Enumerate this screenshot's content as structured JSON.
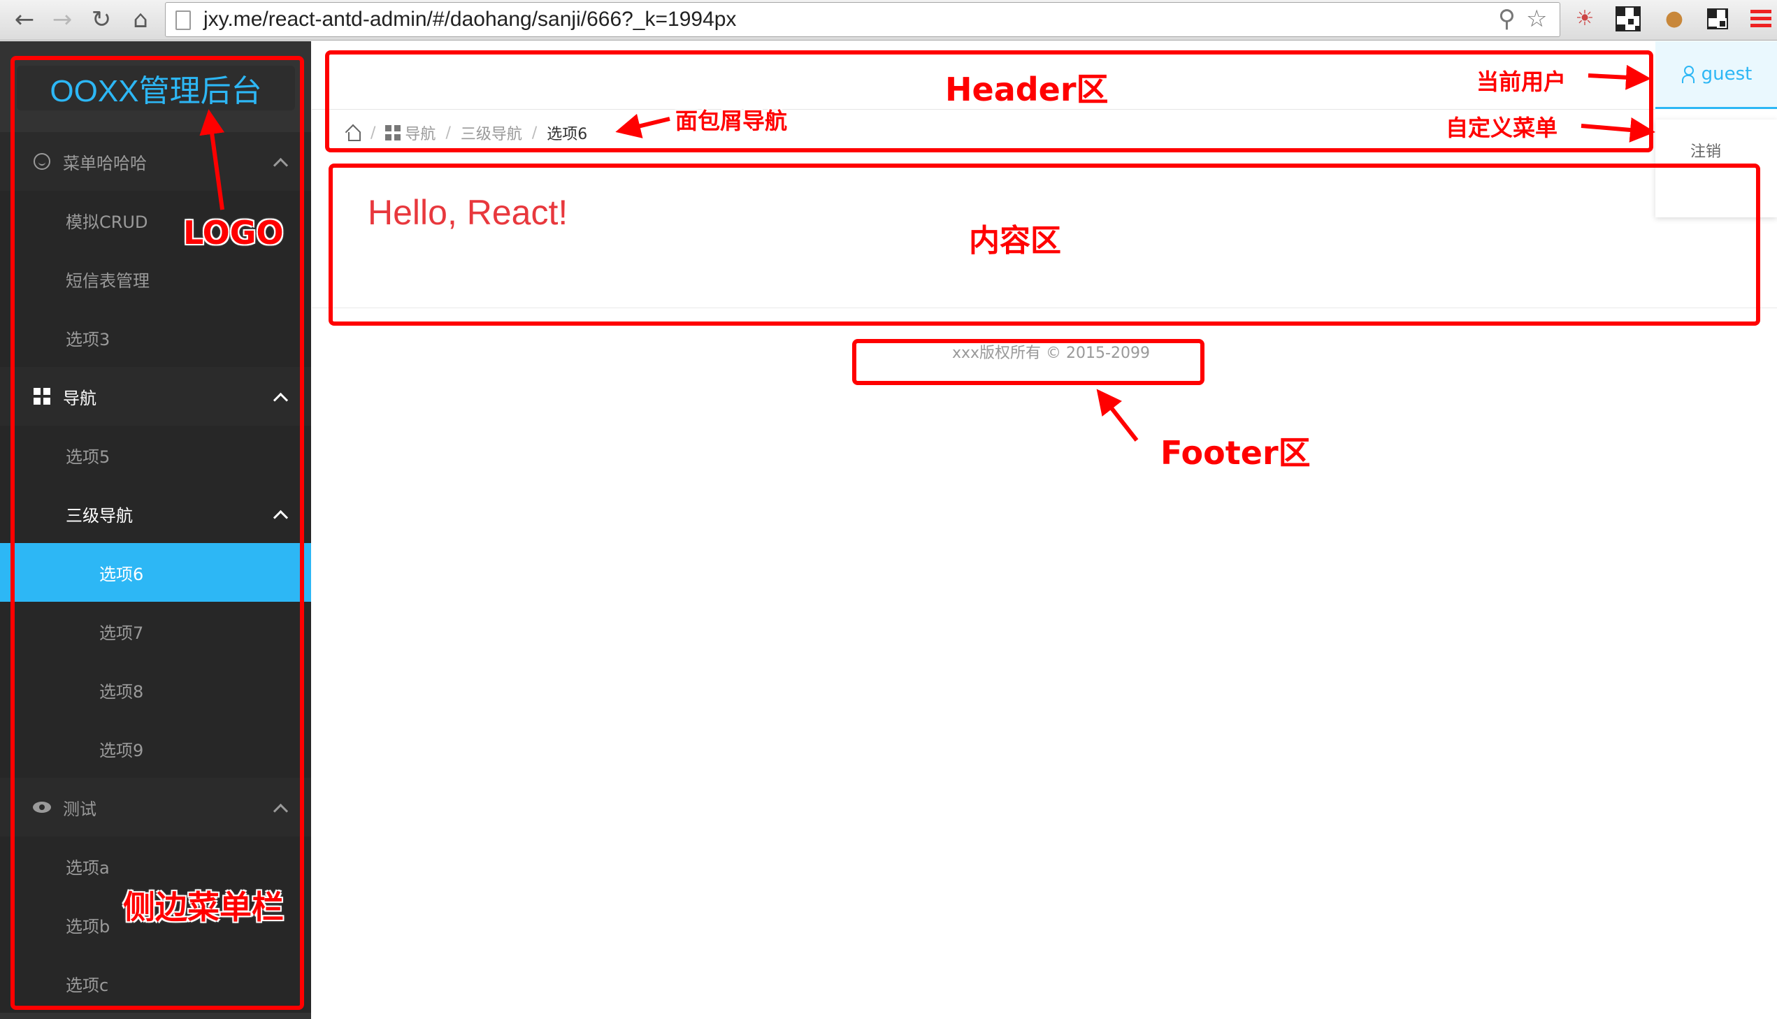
{
  "browser": {
    "url": "jxy.me/react-antd-admin/#/daohang/sanji/666?_k=1994px"
  },
  "app": {
    "logo_text": "OOXX管理后台",
    "brand_color": "#2db7f5",
    "sidebar_bg": "#333333"
  },
  "sidebar": {
    "groups": [
      {
        "label": "菜单哈哈哈",
        "icon": "smile-icon",
        "expanded": true,
        "items": [
          "模拟CRUD",
          "短信表管理",
          "选项3"
        ]
      },
      {
        "label": "导航",
        "icon": "appstore-icon",
        "expanded": true,
        "items": [
          "选项5"
        ],
        "subgroup": {
          "label": "三级导航",
          "expanded": true,
          "items": [
            "选项6",
            "选项7",
            "选项8",
            "选项9"
          ],
          "selected": "选项6"
        }
      },
      {
        "label": "测试",
        "icon": "eye-icon",
        "expanded": true,
        "items": [
          "选项a",
          "选项b",
          "选项c"
        ]
      }
    ]
  },
  "header": {
    "user": "guest",
    "dropdown_item": "注销",
    "breadcrumb": [
      "导航",
      "三级导航",
      "选项6"
    ]
  },
  "content": {
    "text": "Hello, React!"
  },
  "footer": {
    "text": "xxx版权所有 © 2015-2099"
  },
  "annotations": {
    "header": "Header区",
    "current_user": "当前用户",
    "custom_menu": "自定义菜单",
    "breadcrumb": "面包屑导航",
    "content": "内容区",
    "logo": "LOGO",
    "footer": "Footer区",
    "sidebar": "侧边菜单栏",
    "color": "#ff0000"
  }
}
